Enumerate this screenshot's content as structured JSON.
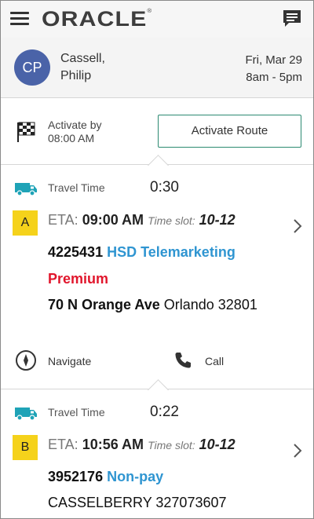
{
  "header": {
    "logo_text": "ORACLE",
    "logo_mark": "®",
    "menu_icon": "hamburger-icon",
    "chat_icon": "chat-icon"
  },
  "resource": {
    "initials": "CP",
    "name_last": "Cassell,",
    "name_first": "Philip",
    "date": "Fri, Mar 29",
    "hours": "8am - 5pm",
    "avatar_color": "#4a63a8"
  },
  "activation": {
    "label_line1": "Activate by",
    "label_line2": "08:00 AM",
    "button_label": "Activate Route",
    "button_border_color": "#2c8a71"
  },
  "activities": [
    {
      "travel_label": "Travel Time",
      "travel_time": "0:30",
      "badge": "A",
      "eta_label": "ETA:",
      "eta": "09:00 AM",
      "slot_label": "Time slot:",
      "slot": "10-12",
      "id": "4225431",
      "type": "HSD Telemarketing",
      "priority": "Premium",
      "street": "70 N Orange Ave",
      "city": "Orlando 32801",
      "actions": {
        "navigate": "Navigate",
        "call": "Call"
      }
    },
    {
      "travel_label": "Travel Time",
      "travel_time": "0:22",
      "badge": "B",
      "eta_label": "ETA:",
      "eta": "10:56 AM",
      "slot_label": "Time slot:",
      "slot": "10-12",
      "id": "3952176",
      "type": "Non-pay",
      "address": "CASSELBERRY 327073607"
    }
  ],
  "colors": {
    "badge": "#f5d21b",
    "link_blue": "#2f95d1",
    "priority_red": "#e1162c",
    "travel_icon": "#1fa3b7"
  }
}
